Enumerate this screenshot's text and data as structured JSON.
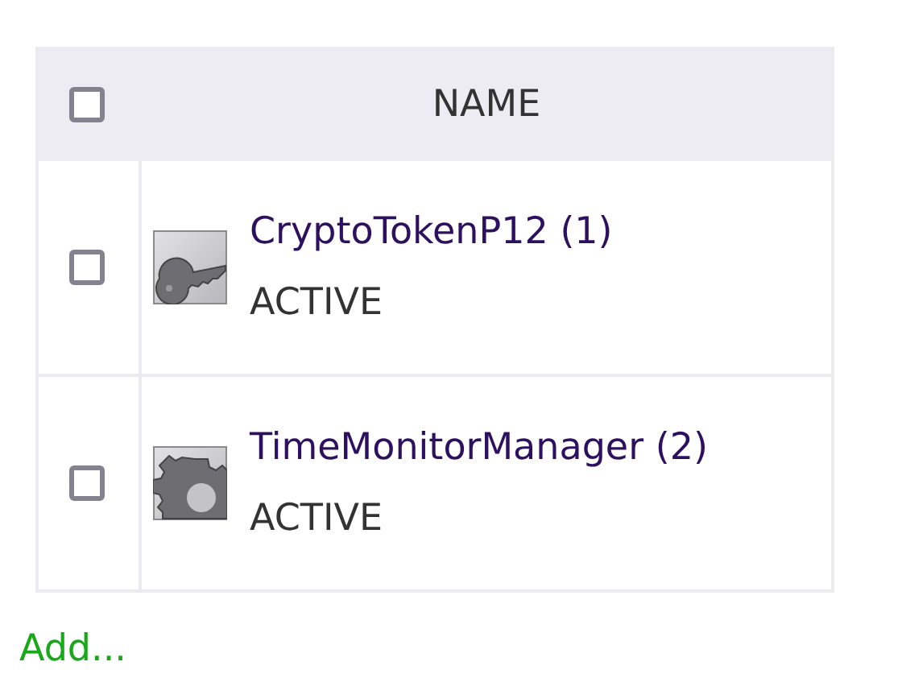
{
  "table": {
    "select_all": {
      "checked": false
    },
    "columns": [
      "NAME"
    ],
    "rows": [
      {
        "checked": false,
        "kind": "key",
        "name": "CryptoTokenP12 (1)",
        "status": "ACTIVE"
      },
      {
        "checked": false,
        "kind": "gear",
        "name": "TimeMonitorManager (2)",
        "status": "ACTIVE"
      }
    ]
  },
  "add_link": "Add..."
}
